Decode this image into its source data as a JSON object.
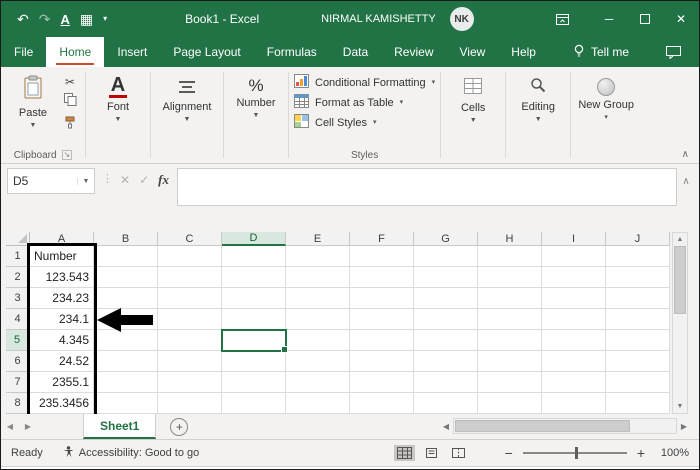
{
  "title_bar": {
    "title": "Book1 - Excel",
    "user_name": "NIRMAL KAMISHETTY",
    "user_initials": "NK"
  },
  "tabs": [
    {
      "label": "File",
      "active": false
    },
    {
      "label": "Home",
      "active": true
    },
    {
      "label": "Insert",
      "active": false
    },
    {
      "label": "Page Layout",
      "active": false
    },
    {
      "label": "Formulas",
      "active": false
    },
    {
      "label": "Data",
      "active": false
    },
    {
      "label": "Review",
      "active": false
    },
    {
      "label": "View",
      "active": false
    },
    {
      "label": "Help",
      "active": false
    }
  ],
  "tell_me_label": "Tell me",
  "ribbon": {
    "paste_label": "Paste",
    "font_label": "Font",
    "alignment_label": "Alignment",
    "number_label": "Number",
    "styles_items": [
      "Conditional Formatting",
      "Format as Table",
      "Cell Styles"
    ],
    "cells_label": "Cells",
    "editing_label": "Editing",
    "new_group_label": "New Group",
    "clipboard_group_label": "Clipboard",
    "styles_group_label": "Styles"
  },
  "formula_bar": {
    "name_box": "D5",
    "fx_label": "fx",
    "formula_value": ""
  },
  "grid": {
    "columns": [
      "A",
      "B",
      "C",
      "D",
      "E",
      "F",
      "G",
      "H",
      "I",
      "J"
    ],
    "row_count": 8,
    "selected_cell": "D5",
    "selected_column": "D",
    "selected_row": 5,
    "column_a_values": [
      "Number",
      "123.543",
      "234.23",
      "234.1",
      "4.345",
      "24.52",
      "2355.1",
      "235.3456"
    ]
  },
  "sheet_bar": {
    "sheet_name": "Sheet1"
  },
  "status_bar": {
    "ready_label": "Ready",
    "accessibility_label": "Accessibility: Good to go",
    "zoom_label": "100%"
  },
  "colors": {
    "excel_green": "#217346",
    "underline_red": "#c00000",
    "selection_green": "#217346"
  }
}
